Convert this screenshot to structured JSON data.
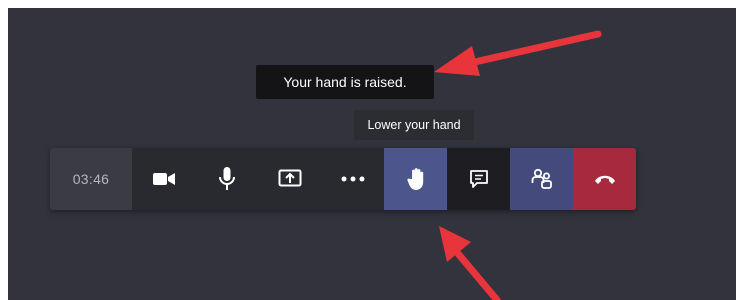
{
  "tooltips": {
    "raised_status": "Your hand is raised.",
    "lower_hand": "Lower your hand"
  },
  "toolbar": {
    "timer": "03:46",
    "buttons": [
      {
        "icon": "camera-icon",
        "label": "Camera"
      },
      {
        "icon": "microphone-icon",
        "label": "Mic"
      },
      {
        "icon": "share-screen-icon",
        "label": "Share"
      },
      {
        "icon": "more-options-icon",
        "label": "More"
      },
      {
        "icon": "raise-hand-icon",
        "label": "Raise hand",
        "active": true
      },
      {
        "icon": "chat-icon",
        "label": "Chat"
      },
      {
        "icon": "participants-icon",
        "label": "People"
      },
      {
        "icon": "hang-up-icon",
        "label": "Leave"
      }
    ]
  },
  "colors": {
    "background": "#33333d",
    "toolbar": "#292930",
    "hand_active": "#4c558c",
    "people": "#444b7c",
    "leave": "#a6293e",
    "annotation_arrow": "#e8353b"
  }
}
